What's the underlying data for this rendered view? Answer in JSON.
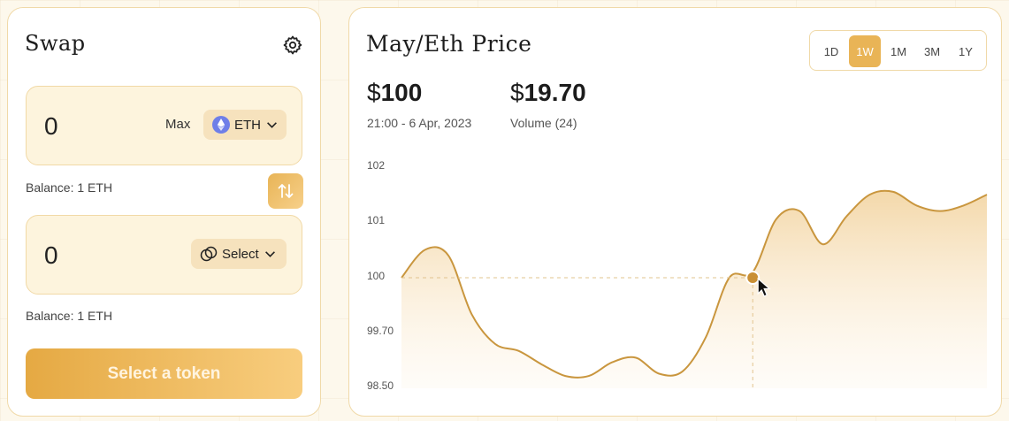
{
  "swap": {
    "title": "Swap",
    "from": {
      "amount": "0",
      "max_label": "Max",
      "token_label": "ETH",
      "balance": "Balance: 1 ETH"
    },
    "to": {
      "amount": "0",
      "token_label": "Select",
      "balance": "Balance: 1 ETH"
    },
    "action_label": "Select a token"
  },
  "chart": {
    "title": "May/Eth Price",
    "ranges": [
      "1D",
      "1W",
      "1M",
      "3M",
      "1Y"
    ],
    "active_range": "1W",
    "price": {
      "currency": "$",
      "value": "100",
      "caption": "21:00 - 6 Apr, 2023"
    },
    "volume": {
      "currency": "$",
      "value": "19.70",
      "caption": "Volume (24)"
    }
  },
  "colors": {
    "accent": "#e9b456",
    "line": "#c9963e",
    "fill_top": "#f3d6a5"
  },
  "chart_data": {
    "type": "area",
    "title": "May/Eth Price",
    "y_ticks": [
      "102",
      "101",
      "100",
      "99.70",
      "98.50"
    ],
    "ylim": [
      98.5,
      102
    ],
    "x": [
      0,
      4,
      8,
      12,
      16,
      20,
      24,
      28,
      32,
      36,
      40,
      44,
      48,
      52,
      56,
      60,
      64,
      68,
      72,
      76,
      80,
      84,
      88,
      92,
      96,
      100
    ],
    "values": [
      100.0,
      100.5,
      100.4,
      99.8,
      99.45,
      99.3,
      99.0,
      98.75,
      98.75,
      99.05,
      99.15,
      98.8,
      98.85,
      99.6,
      100.0,
      100.1,
      101.05,
      101.2,
      100.6,
      101.1,
      101.5,
      101.55,
      101.3,
      101.2,
      101.3,
      101.5
    ],
    "highlight": {
      "x": 60,
      "y": 100,
      "label": "100"
    },
    "grid": false,
    "legend": "none"
  }
}
